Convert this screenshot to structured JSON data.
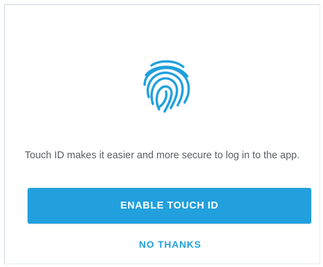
{
  "touch_id_prompt": {
    "icon": "fingerprint-icon",
    "message": "Touch ID makes it easier and more secure to log in to the app.",
    "enable_button_label": "ENABLE TOUCH ID",
    "decline_button_label": "NO THANKS"
  },
  "colors": {
    "accent": "#21a0dd",
    "text": "#5b5f63",
    "background": "#ffffff"
  }
}
